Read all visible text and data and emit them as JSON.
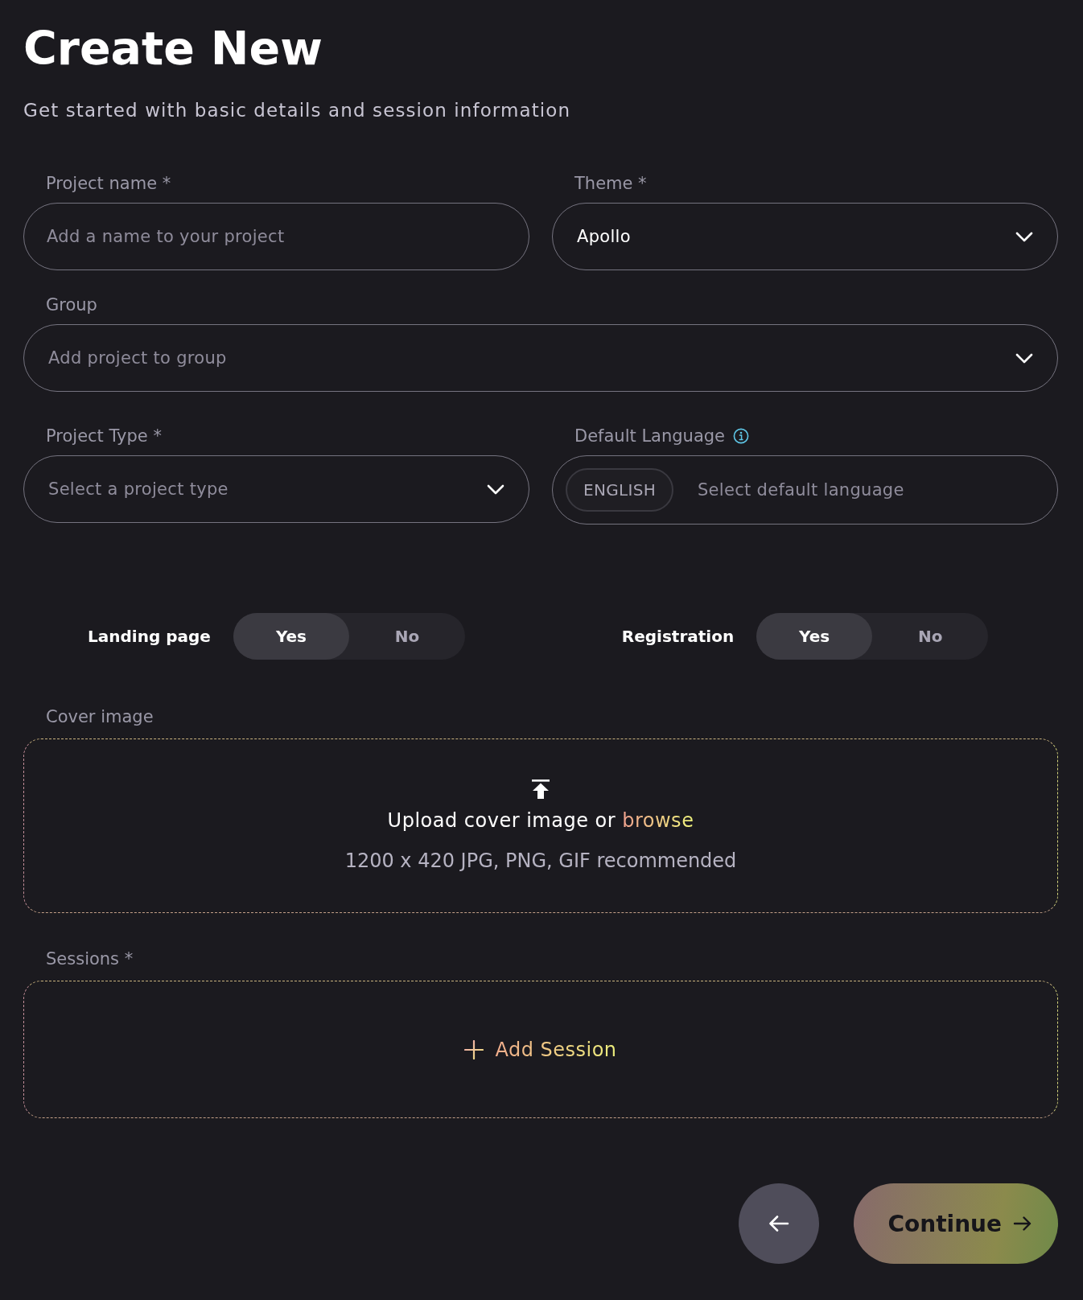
{
  "header": {
    "title": "Create New",
    "subtitle": "Get started with basic details and session information"
  },
  "rows": [
    [
      {
        "kind": "text",
        "label": "Project name *",
        "info_icon": false,
        "placeholder": "Add a name to your project"
      },
      {
        "kind": "select",
        "label": "Theme *",
        "info_icon": false,
        "value": "Apollo"
      }
    ],
    [
      {
        "kind": "select",
        "label": "Group",
        "info_icon": false,
        "placeholder": "Add project to group"
      }
    ],
    [
      {
        "kind": "select",
        "label": "Project Type *",
        "info_icon": false,
        "placeholder": "Select a project type"
      },
      {
        "kind": "language",
        "label": "Default Language",
        "info_icon": true,
        "chip": "ENGLISH",
        "placeholder": "Select default language"
      }
    ]
  ],
  "toggles": [
    {
      "label": "Landing page",
      "options": [
        {
          "label": "Yes",
          "selected": true
        },
        {
          "label": "No",
          "selected": false
        }
      ]
    },
    {
      "label": "Registration",
      "options": [
        {
          "label": "Yes",
          "selected": true
        },
        {
          "label": "No",
          "selected": false
        }
      ]
    }
  ],
  "cover_image": {
    "label": "Cover image",
    "prompt": "Upload cover image or",
    "link": "browse",
    "hint": "1200 x 420 JPG, PNG, GIF recommended"
  },
  "sessions": {
    "label": "Sessions *",
    "action": "Add Session"
  },
  "actions": [
    {
      "kind": "back"
    },
    {
      "kind": "continue",
      "label": "Continue"
    }
  ]
}
